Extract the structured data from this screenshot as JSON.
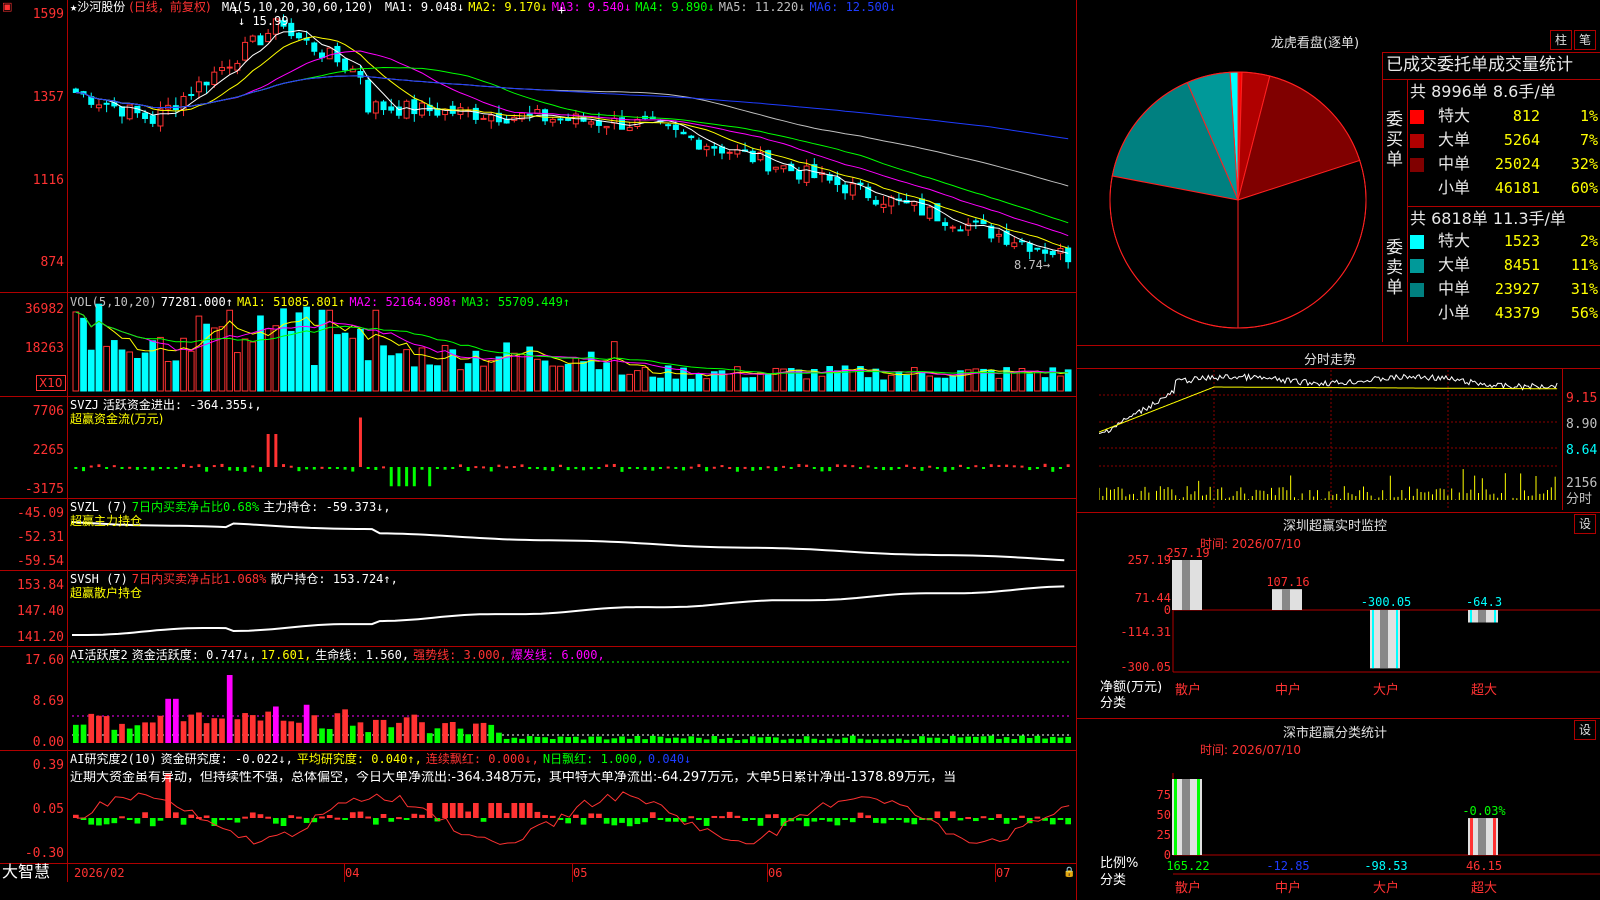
{
  "stock": {
    "star": "★",
    "name": "沙河股份",
    "period": "(日线，前复权)"
  },
  "main_chart": {
    "ma_label": "MA(5,10,20,30,60,120)",
    "ma_items": [
      {
        "label": "MA1: 9.048↓",
        "color": "#ffffff"
      },
      {
        "label": "MA2: 9.170↓",
        "color": "#ffff00"
      },
      {
        "label": "MA3: 9.540↓",
        "color": "#ff00ff"
      },
      {
        "label": "MA4: 9.890↓",
        "color": "#00ff00"
      },
      {
        "label": "MA5: 11.220↓",
        "color": "#c0c0c0"
      },
      {
        "label": "MA6: 12.500↓",
        "color": "#1f3cff"
      }
    ],
    "y_labels": [
      "1599",
      "1357",
      "1116",
      "874"
    ],
    "high_marker": "15.99",
    "low_marker": "8.74→",
    "plus_marks": [
      "+",
      "+"
    ]
  },
  "vol_panel": {
    "header": [
      "VOL(5,10,20)",
      "77281.000↑",
      "MA1: 51085.801↑",
      "MA2: 52164.898↑",
      "MA3: 55709.449↑"
    ],
    "y_labels": [
      "36982",
      "18263"
    ],
    "unit": "X10"
  },
  "svzj_panel": {
    "header": [
      "SVZJ",
      "活跃资金进出: -364.355↓,"
    ],
    "subheader": "超赢资金流(万元)",
    "y_labels": [
      "7706",
      "2265",
      "-3175"
    ]
  },
  "svzl_panel": {
    "header": [
      "SVZL (7)",
      "7日内买卖净占比0.68%",
      "主力持仓: -59.373↓,"
    ],
    "subheader": "超赢主力持仓",
    "y_labels": [
      "-45.09",
      "-52.31",
      "-59.54"
    ]
  },
  "svsh_panel": {
    "header": [
      "SVSH (7)",
      "7日内买卖净占比1.068%",
      "散户持仓: 153.724↑,"
    ],
    "subheader": "超赢散户持仓",
    "y_labels": [
      "153.84",
      "147.40",
      "141.20"
    ]
  },
  "ai_active_panel": {
    "header": [
      "AI活跃度2",
      "资金活跃度: 0.747↓,",
      "17.601,",
      "生命线: 1.560,",
      "强势线: 3.000,",
      "爆发线: 6.000,"
    ],
    "y_labels": [
      "17.60",
      "8.69",
      "0.00"
    ]
  },
  "ai_research_panel": {
    "header": [
      "AI研究度2(10)",
      "资金研究度: -0.022↓,",
      "平均研究度: 0.040↑,",
      "连续飘红: 0.000↓,",
      "N日飘红: 1.000,",
      "0.040↓"
    ],
    "comment": "近期大资金虽有异动，但持续性不强，总体偏空，今日大单净流出:-364.348万元，其中特大单净流出:-64.297万元，大单5日累计净出-1378.89万元，当",
    "y_labels": [
      "0.39",
      "0.05",
      "-0.30"
    ]
  },
  "bottom_bar": {
    "brand": "大智慧",
    "dates": [
      "2026/02",
      "04",
      "05",
      "06",
      "07"
    ]
  },
  "dragon_tiger": {
    "title": "龙虎看盘(逐单)",
    "btn_bar": "柱",
    "btn_pen": "笔",
    "stats_title": "已成交委托单成交量统计",
    "buy_label": "委买单",
    "buy_summary": "共 8996单 8.6手/单",
    "buy_rows": [
      {
        "label": "特大",
        "value": "812",
        "pct": "1%",
        "color": "#ff0000"
      },
      {
        "label": "大单",
        "value": "5264",
        "pct": "7%",
        "color": "#b00000"
      },
      {
        "label": "中单",
        "value": "25024",
        "pct": "32%",
        "color": "#800000"
      },
      {
        "label": "小单",
        "value": "46181",
        "pct": "60%",
        "color": "#000000"
      }
    ],
    "sell_label": "委卖单",
    "sell_summary": "共 6818单 11.3手/单",
    "sell_rows": [
      {
        "label": "特大",
        "value": "1523",
        "pct": "2%",
        "color": "#00ffff"
      },
      {
        "label": "大单",
        "value": "8451",
        "pct": "11%",
        "color": "#009999"
      },
      {
        "label": "中单",
        "value": "23927",
        "pct": "31%",
        "color": "#008080"
      },
      {
        "label": "小单",
        "value": "43379",
        "pct": "56%",
        "color": "#000000"
      }
    ]
  },
  "intraday": {
    "title": "分时走势",
    "y_labels": [
      "9.15",
      "8.90",
      "8.64"
    ],
    "vol_labels": [
      "2156",
      "分时"
    ]
  },
  "sz_monitor": {
    "title": "深圳超赢实时监控",
    "settings": "设",
    "time": "时间: 2026/07/10",
    "y_labels": [
      "257.19",
      "71.44",
      "0",
      "-114.31",
      "-300.05"
    ],
    "unit_label": "净额(万元)",
    "cat_label": "分类",
    "categories": [
      "散户",
      "中户",
      "大户",
      "超大"
    ],
    "values": [
      "257.19",
      "107.16",
      "-300.05",
      "-64.3"
    ]
  },
  "sz_class": {
    "title": "深市超赢分类统计",
    "settings": "设",
    "time": "时间: 2026/07/10",
    "y_labels": [
      "75",
      "50",
      "25",
      "0"
    ],
    "unit_label": "比例%",
    "cat_label": "分类",
    "categories": [
      "散户",
      "中户",
      "大户",
      "超大"
    ],
    "values": [
      "165.22",
      "-12.85",
      "-98.53",
      "46.15"
    ],
    "top_label": "-0.03%"
  },
  "chart_data": [
    {
      "type": "pie",
      "title": "龙虎看盘(逐单)",
      "series": [
        {
          "name": "委买单",
          "categories": [
            "特大",
            "大单",
            "中单",
            "小单"
          ],
          "values": [
            1,
            7,
            32,
            60
          ]
        },
        {
          "name": "委卖单",
          "categories": [
            "特大",
            "大单",
            "中单",
            "小单"
          ],
          "values": [
            2,
            11,
            31,
            56
          ]
        }
      ]
    },
    {
      "type": "bar",
      "title": "深圳超赢实时监控",
      "categories": [
        "散户",
        "中户",
        "大户",
        "超大"
      ],
      "values": [
        257.19,
        107.16,
        -300.05,
        -64.3
      ],
      "ylabel": "净额(万元)",
      "ylim": [
        -300.05,
        257.19
      ]
    },
    {
      "type": "bar",
      "title": "深市超赢分类统计",
      "categories": [
        "散户",
        "中户",
        "大户",
        "超大"
      ],
      "values": [
        165.22,
        -12.85,
        -98.53,
        46.15
      ],
      "ylabel": "比例%",
      "ylim": [
        0,
        75
      ]
    }
  ]
}
